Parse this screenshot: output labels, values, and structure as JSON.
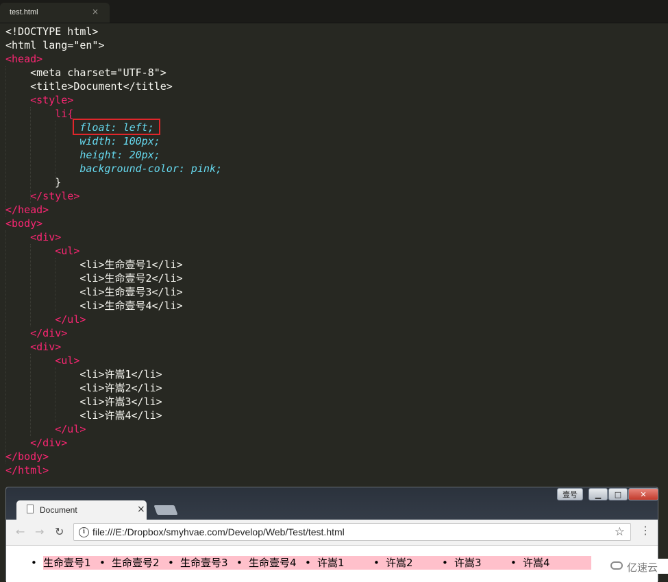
{
  "editor": {
    "tab": {
      "title": "test.html",
      "close": "×"
    },
    "highlight_note": "float: left;"
  },
  "code": {
    "lines": [
      "<!DOCTYPE html>",
      "<html lang=\"en\">",
      "<head>",
      "    <meta charset=\"UTF-8\">",
      "    <title>Document</title>",
      "    <style>",
      "        li{",
      "            float: left;",
      "            width: 100px;",
      "            height: 20px;",
      "            background-color: pink;",
      "        }",
      "    </style>",
      "</head>",
      "<body>",
      "    <div>",
      "        <ul>",
      "            <li>生命壹号1</li>",
      "            <li>生命壹号2</li>",
      "            <li>生命壹号3</li>",
      "            <li>生命壹号4</li>",
      "        </ul>",
      "    </div>",
      "    <div>",
      "        <ul>",
      "            <li>许嵩1</li>",
      "            <li>许嵩2</li>",
      "            <li>许嵩3</li>",
      "            <li>许嵩4</li>",
      "        </ul>",
      "    </div>",
      "</body>",
      "</html>"
    ]
  },
  "browser": {
    "window_label": "壹号",
    "win_min": "▁",
    "win_max": "□",
    "win_close": "✕",
    "tab_title": "Document",
    "tab_close": "×",
    "back": "←",
    "forward": "→",
    "reload": "↻",
    "info": "i",
    "url": "file:///E:/Dropbox/smyhvae.com/Develop/Web/Test/test.html",
    "star": "☆",
    "menu": "⋮",
    "list_items": [
      "生命壹号1",
      "生命壹号2",
      "生命壹号3",
      "生命壹号4",
      "许嵩1",
      "许嵩2",
      "许嵩3",
      "许嵩4"
    ],
    "list_bg": "#ffc0cb"
  },
  "watermark": {
    "text": "亿速云"
  },
  "colors": {
    "editor_bg": "#272822",
    "tag": "#f92672",
    "attr": "#a6e22e",
    "string": "#e6db74",
    "property": "#66d9ef",
    "number": "#ae81ff",
    "highlight_border": "#e0262b"
  }
}
